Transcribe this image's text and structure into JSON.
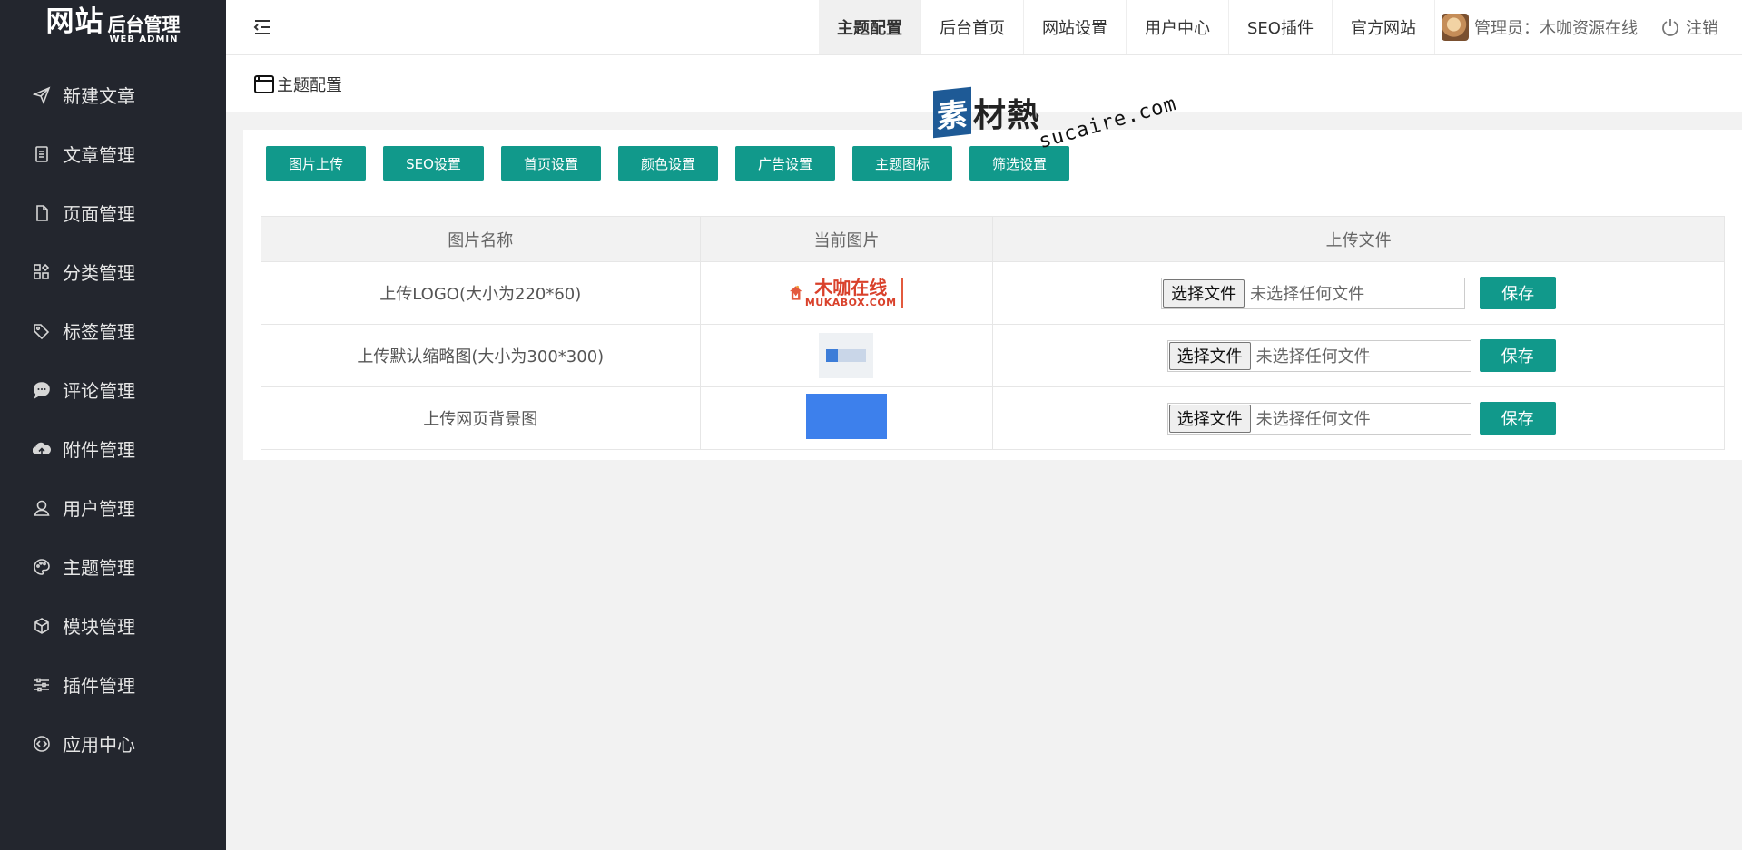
{
  "logo": {
    "main": "网站",
    "cn": "后台管理",
    "en": "WEB ADMIN"
  },
  "sidebar": {
    "items": [
      {
        "label": "新建文章",
        "icon": "send-icon"
      },
      {
        "label": "文章管理",
        "icon": "document-list-icon"
      },
      {
        "label": "页面管理",
        "icon": "page-icon"
      },
      {
        "label": "分类管理",
        "icon": "category-grid-icon"
      },
      {
        "label": "标签管理",
        "icon": "tag-icon"
      },
      {
        "label": "评论管理",
        "icon": "comment-icon"
      },
      {
        "label": "附件管理",
        "icon": "cloud-upload-icon"
      },
      {
        "label": "用户管理",
        "icon": "user-icon"
      },
      {
        "label": "主题管理",
        "icon": "palette-icon"
      },
      {
        "label": "模块管理",
        "icon": "cube-icon"
      },
      {
        "label": "插件管理",
        "icon": "sliders-icon"
      },
      {
        "label": "应用中心",
        "icon": "code-circle-icon"
      }
    ]
  },
  "header": {
    "tabs": [
      {
        "label": "主题配置",
        "active": true
      },
      {
        "label": "后台首页",
        "active": false
      },
      {
        "label": "网站设置",
        "active": false
      },
      {
        "label": "用户中心",
        "active": false
      },
      {
        "label": "SEO插件",
        "active": false
      },
      {
        "label": "官方网站",
        "active": false
      }
    ],
    "user_label": "管理员：木咖资源在线",
    "logout_label": "注销"
  },
  "breadcrumb": {
    "title": "主题配置"
  },
  "watermark": {
    "badge": "素",
    "cn": "材熱",
    "en": "sucaire.com"
  },
  "settings_tabs": [
    "图片上传",
    "SEO设置",
    "首页设置",
    "颜色设置",
    "广告设置",
    "主题图标",
    "筛选设置"
  ],
  "table": {
    "headers": [
      "图片名称",
      "当前图片",
      "上传文件"
    ],
    "rows": [
      {
        "name": "上传LOGO(大小为220*60)",
        "image": "logo",
        "choose": "选择文件",
        "status": "未选择任何文件",
        "save": "保存"
      },
      {
        "name": "上传默认缩略图(大小为300*300)",
        "image": "thumbnail",
        "choose": "选择文件",
        "status": "未选择任何文件",
        "save": "保存"
      },
      {
        "name": "上传网页背景图",
        "image": "background",
        "choose": "选择文件",
        "status": "未选择任何文件",
        "save": "保存"
      }
    ]
  },
  "logo_image": {
    "title": "木咖在线",
    "subtitle": "MUKABOX.COM"
  },
  "colors": {
    "accent": "#11998b",
    "sidebar_bg": "#23262e",
    "bg_image_blue": "#3d80ec"
  }
}
